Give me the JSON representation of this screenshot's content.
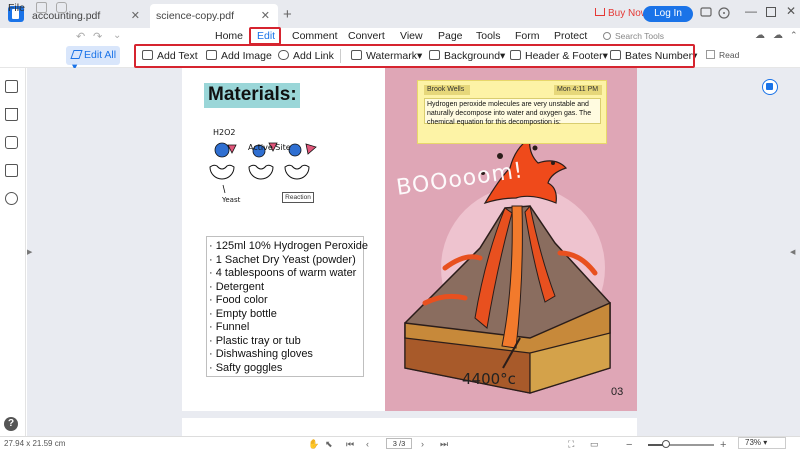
{
  "tabs": [
    {
      "label": "accounting.pdf",
      "active": false
    },
    {
      "label": "science-copy.pdf",
      "active": true
    }
  ],
  "titlebar": {
    "buy_now": "Buy Now",
    "login": "Log In"
  },
  "menu": {
    "file": "File",
    "items": [
      "Home",
      "Edit",
      "Comment",
      "Convert",
      "View",
      "Page",
      "Tools",
      "Form",
      "Protect"
    ],
    "active": "Edit",
    "search_placeholder": "Search Tools"
  },
  "toolbar": {
    "edit_all": "Edit All",
    "tools": [
      "Add Text",
      "Add Image",
      "Add Link",
      "Watermark",
      "Background",
      "Header & Footer",
      "Bates Number"
    ],
    "read": "Read"
  },
  "document": {
    "heading": "Materials:",
    "sketch_labels": {
      "h2o2": "H2O2",
      "active_site": "Active Site",
      "yeast": "Yeast",
      "reaction": "Reaction"
    },
    "materials_list": [
      "· 125ml 10% Hydrogen Peroxide",
      "· 1 Sachet Dry Yeast (powder)",
      "· 4 tablespoons of warm water",
      "· Detergent",
      "· Food color",
      "· Empty bottle",
      "· Funnel",
      "· Plastic tray or tub",
      "· Dishwashing gloves",
      "· Safty goggles"
    ],
    "note": {
      "author": "Brook Wells",
      "time": "Mon 4:11 PM",
      "body": "Hydrogen peroxide molecules are very unstable and naturally decompose into water and oxygen gas. The chemical equation for this decompostion is:"
    },
    "boom_text": "BOOooom!",
    "temperature": "4400°c",
    "page_number": "03"
  },
  "statusbar": {
    "dimensions": "27.94 x 21.59 cm",
    "page_indicator": "3 /3",
    "zoom": "73%",
    "zoom_fraction": 0.27
  },
  "colors": {
    "accent": "#1a73e8",
    "highlight_box": "#d6242f",
    "volcano_bg": "#dfa6b6",
    "heading_bg": "#9ad6d8"
  }
}
